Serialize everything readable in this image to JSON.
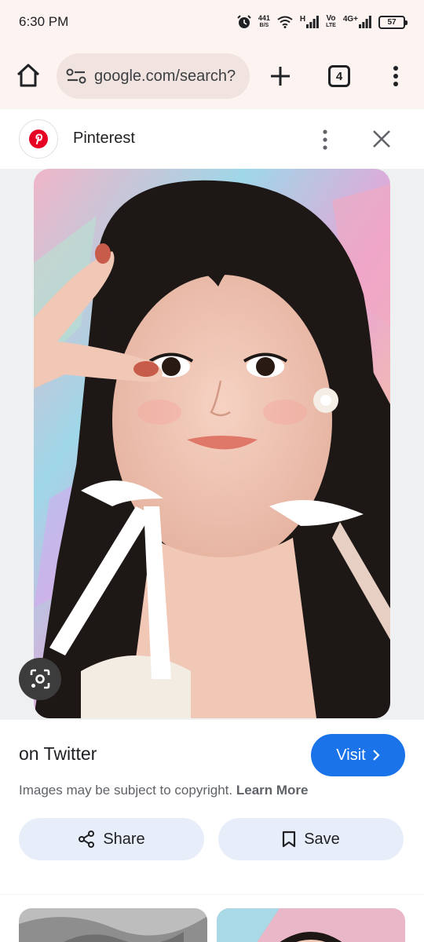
{
  "status_bar": {
    "time": "6:30 PM",
    "net_speed_value": "441",
    "net_speed_unit": "B/S",
    "signal1_label": "H",
    "volte_label_top": "Vo",
    "volte_label_bottom": "LTE",
    "signal2_label": "4G+",
    "battery_level": "57"
  },
  "browser": {
    "url": "google.com/search?",
    "tab_count": "4"
  },
  "panel": {
    "source_name": "Pinterest",
    "title": "on Twitter",
    "visit_label": "Visit",
    "copyright_text": "Images may be subject to copyright.",
    "learn_more_label": "Learn More",
    "share_label": "Share",
    "save_label": "Save"
  },
  "colors": {
    "accent": "#1a73e8",
    "pinterest_red": "#e60023",
    "chrome_bar": "#fdf3f1",
    "action_button": "#e8eef9"
  }
}
